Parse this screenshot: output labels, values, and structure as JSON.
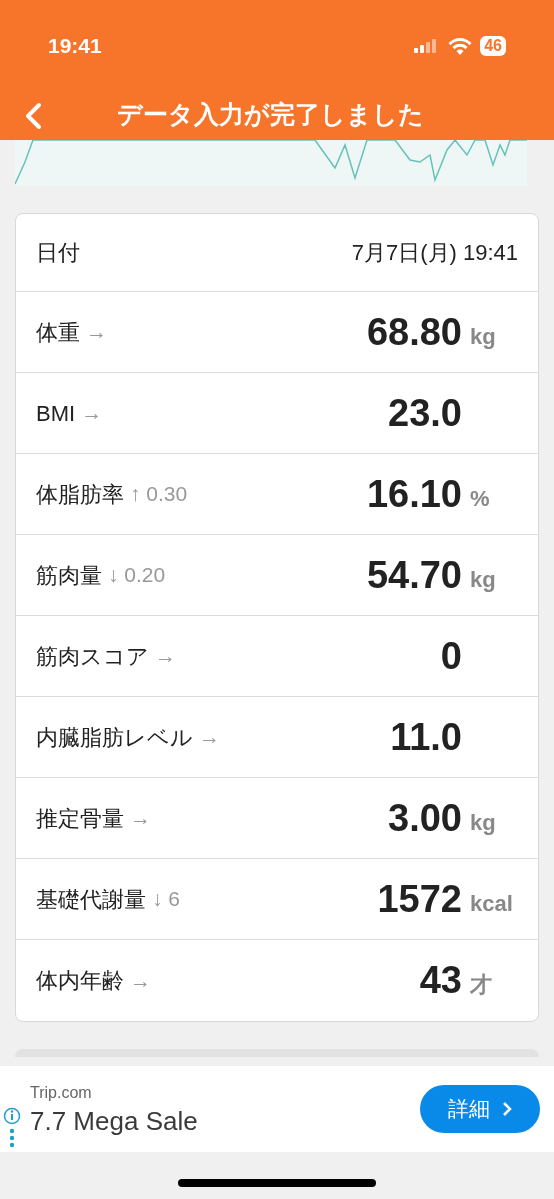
{
  "status_bar": {
    "time": "19:41",
    "battery": "46"
  },
  "header": {
    "title": "データ入力が完了しました"
  },
  "date_row": {
    "label": "日付",
    "value": "7月7日(月) 19:41"
  },
  "rows": [
    {
      "label": "体重",
      "trend": "→",
      "value": "68.80",
      "unit": "kg"
    },
    {
      "label": "BMI",
      "trend": "→",
      "value": "23.0"
    },
    {
      "label": "体脂肪率",
      "trend": "↑ 0.30",
      "value": "16.10",
      "unit": "%"
    },
    {
      "label": "筋肉量",
      "trend": "↓ 0.20",
      "value": "54.70",
      "unit": "kg"
    },
    {
      "label": "筋肉スコア",
      "trend": "→",
      "value": "0"
    },
    {
      "label": "内臓脂肪レベル",
      "trend": "→",
      "value": "11.0"
    },
    {
      "label": "推定骨量",
      "trend": "→",
      "value": "3.00",
      "unit": "kg"
    },
    {
      "label": "基礎代謝量",
      "trend": "↓ 6",
      "value": "1572",
      "unit": "kcal"
    },
    {
      "label": "体内年齢",
      "trend": "→",
      "value": "43",
      "unit": "才"
    }
  ],
  "ad": {
    "advertiser": "Trip.com",
    "headline": "7.7 Mega Sale",
    "button": "詳細"
  }
}
